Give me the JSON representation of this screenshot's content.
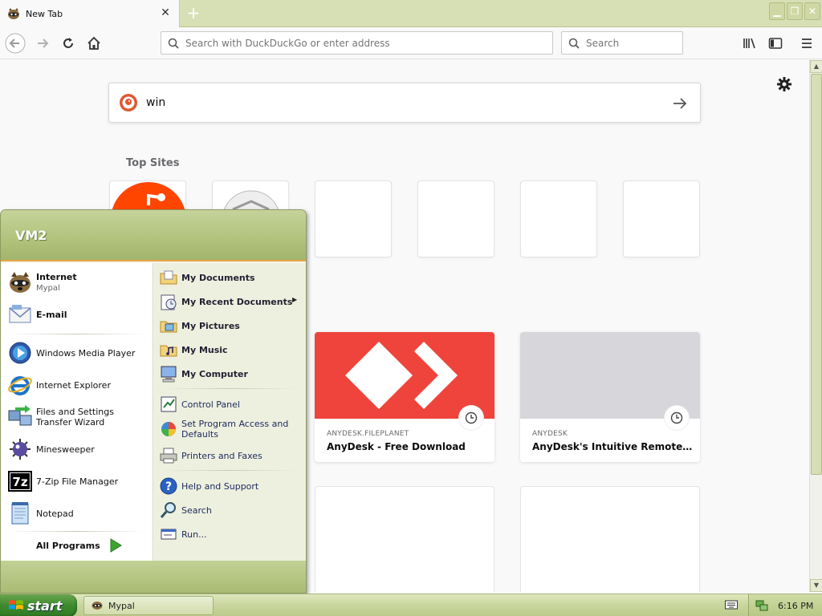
{
  "browser": {
    "tab_title": "New Tab",
    "tab_close": "✕",
    "new_tab": "+",
    "url_placeholder": "Search with DuckDuckGo or enter address",
    "search_placeholder": "Search"
  },
  "newtab": {
    "search_value": "win",
    "top_sites_title": "Top Sites",
    "highlights": [
      {
        "host": "ANYDESK.FILEPLANET",
        "title": "AnyDesk - Free Download"
      },
      {
        "host": "ANYDESK",
        "title": "AnyDesk's Intuitive Remote Des..."
      }
    ]
  },
  "start_menu": {
    "user": "VM2",
    "pinned": [
      {
        "label": "Internet",
        "sub": "Mypal"
      },
      {
        "label": "E-mail",
        "sub": ""
      }
    ],
    "recent": [
      "Windows Media Player",
      "Internet Explorer",
      "Files and Settings Transfer Wizard",
      "Minesweeper",
      "7-Zip File Manager",
      "Notepad"
    ],
    "all_programs": "All Programs",
    "places": [
      "My Documents",
      "My Recent Documents",
      "My Pictures",
      "My Music",
      "My Computer"
    ],
    "system": [
      "Control Panel",
      "Set Program Access and Defaults",
      "Printers and Faxes"
    ],
    "help": [
      "Help and Support",
      "Search",
      "Run..."
    ]
  },
  "taskbar": {
    "start_label": "start",
    "task_label": "Mypal",
    "clock": "6:16 PM"
  },
  "colors": {
    "anydesk_red": "#ef443b",
    "xp_olive": "#b1c27c",
    "start_green": "#3d8a2e",
    "orange_line": "#e8a34a"
  }
}
